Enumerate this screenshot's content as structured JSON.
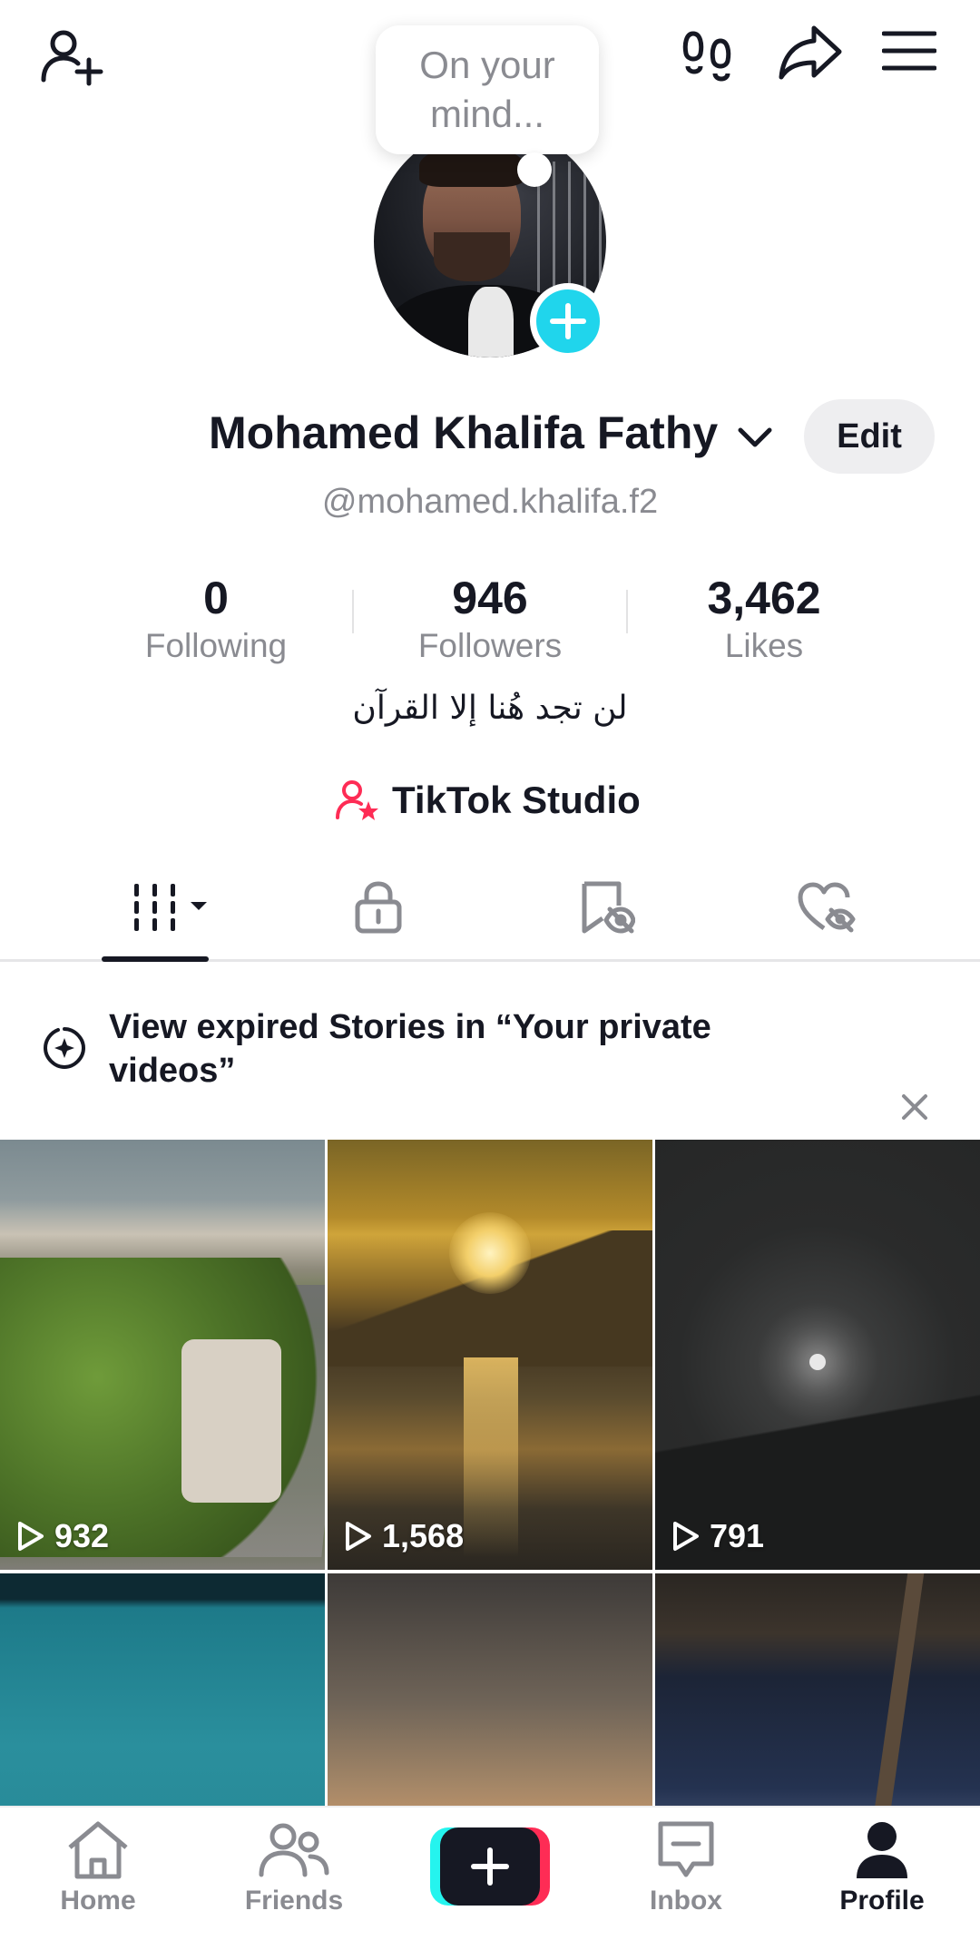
{
  "header": {
    "thought_bubble": "On your mind..."
  },
  "profile": {
    "name": "Mohamed Khalifa Fathy",
    "username": "@mohamed.khalifa.f2",
    "edit_label": "Edit",
    "bio": "لن تجد هُنا إلا القرآن",
    "studio_label": "TikTok Studio"
  },
  "stats": [
    {
      "value": "0",
      "label": "Following"
    },
    {
      "value": "946",
      "label": "Followers"
    },
    {
      "value": "3,462",
      "label": "Likes"
    }
  ],
  "tabs": [
    {
      "icon": "videos-grid-icon",
      "active": true
    },
    {
      "icon": "lock-icon",
      "active": false
    },
    {
      "icon": "bookmark-hidden-icon",
      "active": false
    },
    {
      "icon": "heart-hidden-icon",
      "active": false
    }
  ],
  "banner": {
    "text": "View expired Stories in “Your private videos”"
  },
  "videos": [
    {
      "views": "932"
    },
    {
      "views": "1,568"
    },
    {
      "views": "791"
    },
    {
      "views": ""
    },
    {
      "views": ""
    },
    {
      "views": ""
    }
  ],
  "nav": {
    "home": "Home",
    "friends": "Friends",
    "inbox": "Inbox",
    "profile": "Profile"
  },
  "colors": {
    "accent_cyan": "#20d5ec",
    "accent_red": "#fe2c55",
    "text_primary": "#161823",
    "text_secondary": "#8a8b91"
  }
}
